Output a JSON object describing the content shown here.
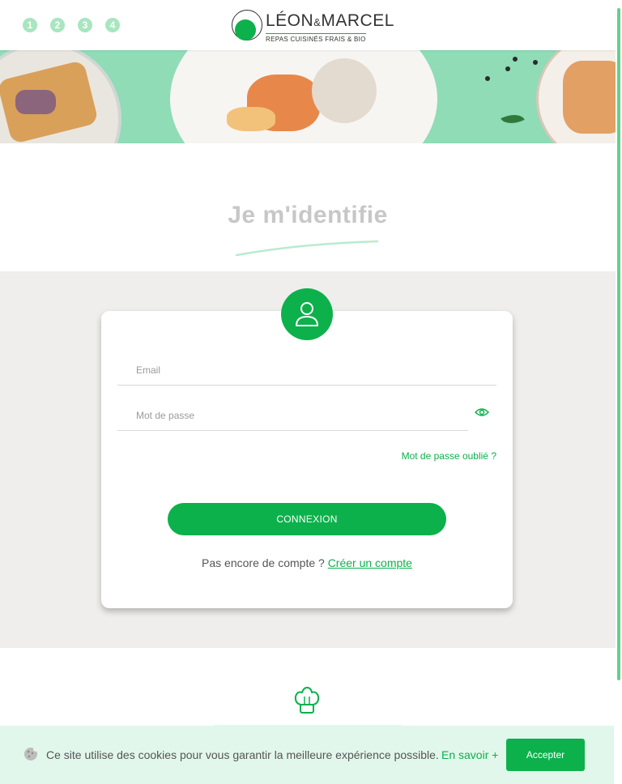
{
  "header": {
    "steps": [
      "1",
      "2",
      "3",
      "4"
    ],
    "logo": {
      "name_left": "LÉON",
      "name_amp": "&",
      "name_right": "MARCEL",
      "tagline": "REPAS CUISINÉS FRAIS & BIO"
    }
  },
  "title": "Je m'identifie",
  "login": {
    "email_placeholder": "Email",
    "password_placeholder": "Mot de passe",
    "forgot_label": "Mot de passe oublié ?",
    "connect_label": "CONNEXION",
    "no_account_text": "Pas encore de compte ?",
    "create_account_label": "Créer un compte"
  },
  "cookie": {
    "text": "Ce site utilise des cookies pour vous garantir la meilleure expérience possible.",
    "more_label": "En savoir +",
    "accept_label": "Accepter"
  },
  "colors": {
    "accent": "#0cb14b",
    "banner_bg": "#8fdcb7",
    "grey_bg": "#efeeec",
    "step_bg": "#a8e6bf"
  },
  "icons": {
    "user": "user-icon",
    "eye": "eye-icon",
    "chef_hat": "chef-hat-icon",
    "cookie": "cookie-icon"
  }
}
